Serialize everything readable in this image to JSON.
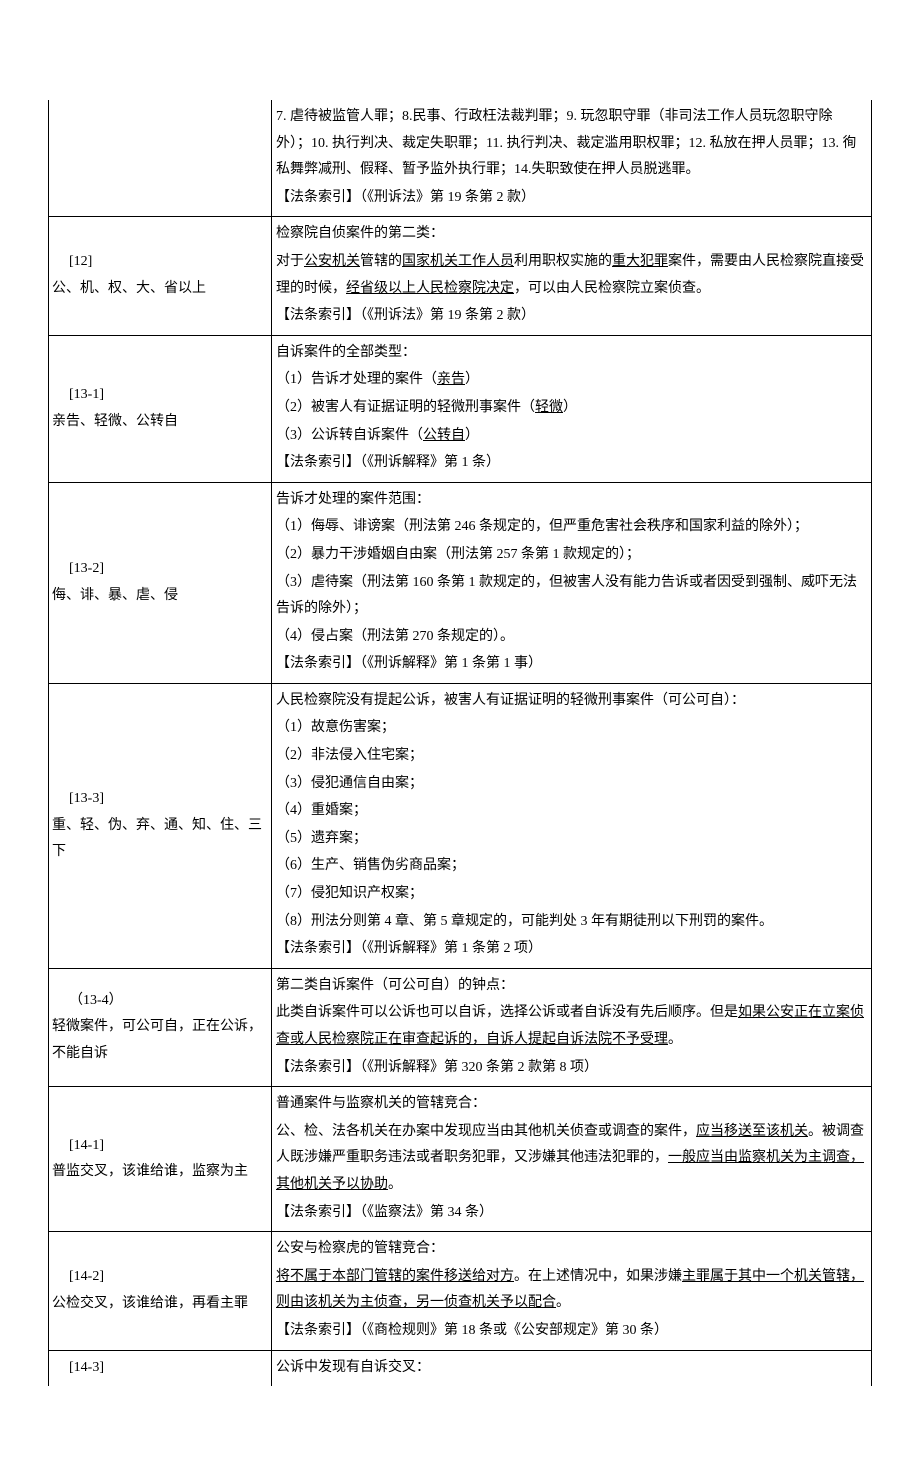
{
  "rows": [
    {
      "left_key": "",
      "left_hint": "",
      "show_left": false,
      "top_open": true,
      "bottom_open": false,
      "body": [
        "7. 虐待被监管人罪；8.民事、行政枉法裁判罪；9. 玩忽职守罪（非司法工作人员玩忽职守除外）；10. 执行判决、裁定失职罪；11. 执行判决、裁定滥用职权罪；12. 私放在押人员罪；13. 徇私舞弊减刑、假释、暂予监外执行罪；14.失职致使在押人员脱逃罪。"
      ],
      "ref": "【法条索引】（《刑诉法》第 19 条第 2 款）"
    },
    {
      "left_key": "[12]",
      "left_hint": "公、机、权、大、省以上",
      "show_left": true,
      "top_open": false,
      "bottom_open": false,
      "body": [
        "检察院自侦案件的第二类：",
        "对于<u>公安机关</u>管辖的<u>国家机关工作人员</u>利用职权实施的<u>重大犯罪</u>案件，需要由人民检察院直接受理的时候，<u>经省级以上人民检察院决定</u>，可以由人民检察院立案侦查。"
      ],
      "ref": "【法条索引】（《刑诉法》第 19 条第 2 款）"
    },
    {
      "left_key": "[13-1]",
      "left_hint": "亲告、轻微、公转自",
      "show_left": true,
      "top_open": false,
      "bottom_open": false,
      "body": [
        "自诉案件的全部类型：",
        "（1）告诉才处理的案件（<u>亲告</u>）",
        "（2）被害人有证据证明的轻微刑事案件（<u>轻微</u>）",
        "（3）公诉转自诉案件（<u>公转自</u>）"
      ],
      "ref": "【法条索引】（《刑诉解释》第 1 条）"
    },
    {
      "left_key": "[13-2]",
      "left_hint": "侮、诽、暴、虐、侵",
      "show_left": true,
      "top_open": false,
      "bottom_open": false,
      "body": [
        "告诉才处理的案件范围：",
        "（1）侮辱、诽谤案（刑法第 246 条规定的，但严重危害社会秩序和国家利益的除外）；",
        "（2）暴力干涉婚姻自由案（刑法第 257 条第 1 款规定的）；",
        "（3）虐待案（刑法第 160 条第 1 款规定的，但被害人没有能力告诉或者因受到强制、威吓无法告诉的除外）；",
        "（4）侵占案（刑法第 270 条规定的）。"
      ],
      "ref": "【法条索引】（《刑诉解释》第 1 条第 1 事）"
    },
    {
      "left_key": "[13-3]",
      "left_hint": "重、轻、伪、弃、通、知、住、三下",
      "show_left": true,
      "top_open": false,
      "bottom_open": false,
      "body": [
        "人民检察院没有提起公诉，被害人有证据证明的轻微刑事案件（可公可自）：",
        "（1）故意伤害案；",
        "（2）非法侵入住宅案；",
        "（3）侵犯通信自由案；",
        "（4）重婚案；",
        "（5）遗弃案；",
        "（6）生产、销售伪劣商品案；",
        "（7）侵犯知识产权案；",
        "（8）刑法分则第 4 章、第 5 章规定的，可能判处 3 年有期徒刑以下刑罚的案件。"
      ],
      "ref": "【法条索引】（《刑诉解释》第 1 条第 2 项）"
    },
    {
      "left_key": "（13-4）",
      "left_hint": "轻微案件，可公可自，正在公诉，不能自诉",
      "show_left": true,
      "top_open": false,
      "bottom_open": false,
      "body": [
        "第二类自诉案件（可公可自）的钟点：",
        "此类自诉案件可以公诉也可以自诉，选择公诉或者自诉没有先后顺序。但是<u>如果公安正在立案侦查或人民检察院正在审查起诉的，自诉人提起自诉法院不予受理</u>。"
      ],
      "ref": "【法条索引】（《刑诉解释》第 320 条第 2 款第 8 项）"
    },
    {
      "left_key": "[14-1]",
      "left_hint": "普监交叉，该谁给谁，监察为主",
      "show_left": true,
      "top_open": false,
      "bottom_open": false,
      "body": [
        "普通案件与监察机关的管辖竞合：",
        "公、检、法各机关在办案中发现应当由其他机关侦查或调查的案件，<u>应当移送至该机关</u>。被调查人既涉嫌严重职务违法或者职务犯罪，又涉嫌其他违法犯罪的，<u>一般应当由监察机关为主调查，其他机关予以协助</u>。"
      ],
      "ref": "【法条索引】（《监察法》第 34 条）"
    },
    {
      "left_key": "[14-2]",
      "left_hint": "公检交叉，该谁给谁，再看主罪",
      "show_left": true,
      "top_open": false,
      "bottom_open": false,
      "body": [
        "公安与检察虎的管辖竞合：",
        "<u>将不属于本部门管辖的案件移送给对方</u>。在上述情况中，如果涉嫌<u>主罪属于其中一个机关管辖，则由该机关为主侦查，另一侦查机关予以配合</u>。"
      ],
      "ref": "【法条索引】（《商检规则》第 18 条或《公安部规定》第 30 条）"
    },
    {
      "left_key": "[14-3]",
      "left_hint": "",
      "show_left": true,
      "top_open": false,
      "bottom_open": true,
      "body": [
        "公诉中发现有自诉交叉："
      ],
      "ref": ""
    }
  ]
}
